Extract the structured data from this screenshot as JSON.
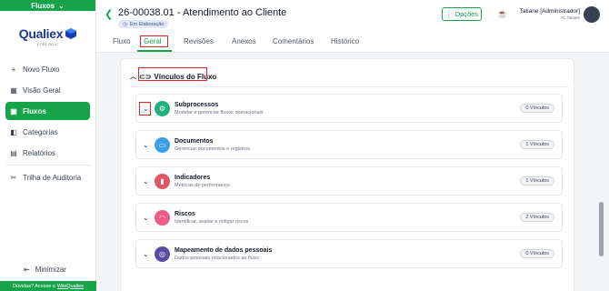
{
  "module": {
    "label": "Fluxos",
    "icon": "chevron-down-icon"
  },
  "logo": {
    "name": "Qualiex",
    "sub": "FORLOGIC"
  },
  "sidebar": {
    "items": [
      {
        "label": "Novo Fluxo",
        "icon": "plus-icon"
      },
      {
        "label": "Visão Geral",
        "icon": "dashboard-icon"
      },
      {
        "label": "Fluxos",
        "icon": "flow-icon"
      },
      {
        "label": "Categorias",
        "icon": "category-icon"
      },
      {
        "label": "Relatórios",
        "icon": "report-icon"
      },
      {
        "label": "Trilha de Auditoria",
        "icon": "audit-icon"
      }
    ],
    "minimize": "Minimizar",
    "help_text": "Dúvidas? Acesse a",
    "help_link": "WikiQualiex"
  },
  "header": {
    "title": "26-00038.01 - Atendimento ao Cliente",
    "status": "Em Elaboração",
    "options_label": "Opções",
    "user_name": "Tatiane [Administrador]",
    "user_company": "FL Tatiane"
  },
  "tabs": [
    {
      "label": "Fluxo"
    },
    {
      "label": "Geral"
    },
    {
      "label": "Revisões"
    },
    {
      "label": "Anexos"
    },
    {
      "label": "Comentários"
    },
    {
      "label": "Histórico"
    }
  ],
  "section": {
    "title": "Vínculos do Fluxo"
  },
  "rows": [
    {
      "title": "Subprocessos",
      "desc": "Modelar e gerenciar fluxos operacionais",
      "badge": "0 Vínculos",
      "color": "#22b07d",
      "icon": "subprocess-icon"
    },
    {
      "title": "Documentos",
      "desc": "Gerenciar documentos e registros",
      "badge": "1 Vínculos",
      "color": "#3b9ee6",
      "icon": "folder-icon"
    },
    {
      "title": "Indicadores",
      "desc": "Métricas de performance",
      "badge": "1 Vínculos",
      "color": "#e25563",
      "icon": "bar-chart-icon"
    },
    {
      "title": "Riscos",
      "desc": "Identificar, avaliar e mitigar riscos",
      "badge": "2 Vínculos",
      "color": "#ec5c86",
      "icon": "risk-icon"
    },
    {
      "title": "Mapeamento de dados pessoais",
      "desc": "Dados pessoais relacionados ao fluxo",
      "badge": "0 Vínculos",
      "color": "#5b4ba8",
      "icon": "database-icon"
    }
  ]
}
